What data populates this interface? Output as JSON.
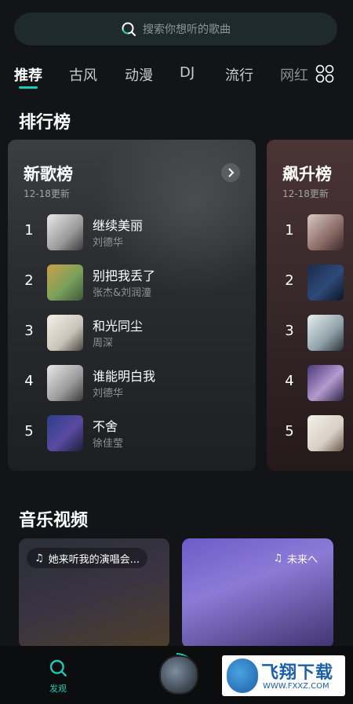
{
  "search": {
    "placeholder": "搜索你想听的歌曲",
    "icon": "search-icon"
  },
  "tabs": [
    {
      "label": "推荐",
      "active": true
    },
    {
      "label": "古风",
      "active": false
    },
    {
      "label": "动漫",
      "active": false
    },
    {
      "label": "DJ",
      "active": false
    },
    {
      "label": "流行",
      "active": false
    },
    {
      "label": "网红",
      "active": false
    }
  ],
  "colors": {
    "accent": "#1fc8b7",
    "background": "#121417"
  },
  "charts_section": {
    "title": "排行榜"
  },
  "charts": [
    {
      "title": "新歌榜",
      "updated": "12-18更新",
      "items": [
        {
          "rank": "1",
          "song": "继续美丽",
          "artist": "刘德华"
        },
        {
          "rank": "2",
          "song": "别把我丢了",
          "artist": "张杰&刘润潼"
        },
        {
          "rank": "3",
          "song": "和光同尘",
          "artist": "周深"
        },
        {
          "rank": "4",
          "song": "谁能明白我",
          "artist": "刘德华"
        },
        {
          "rank": "5",
          "song": "不舍",
          "artist": "徐佳莹"
        }
      ]
    },
    {
      "title": "飙升榜",
      "updated": "12-18更新",
      "items": [
        {
          "rank": "1"
        },
        {
          "rank": "2"
        },
        {
          "rank": "3"
        },
        {
          "rank": "4"
        },
        {
          "rank": "5"
        }
      ]
    }
  ],
  "videos_section": {
    "title": "音乐视频"
  },
  "videos": [
    {
      "label": "她来听我的演唱会..."
    },
    {
      "label": "未来へ"
    }
  ],
  "bottom_nav": {
    "discover_label": "发观"
  },
  "watermark": {
    "title": "飞翔下载",
    "url": "WWW.FXXZ.COM"
  }
}
